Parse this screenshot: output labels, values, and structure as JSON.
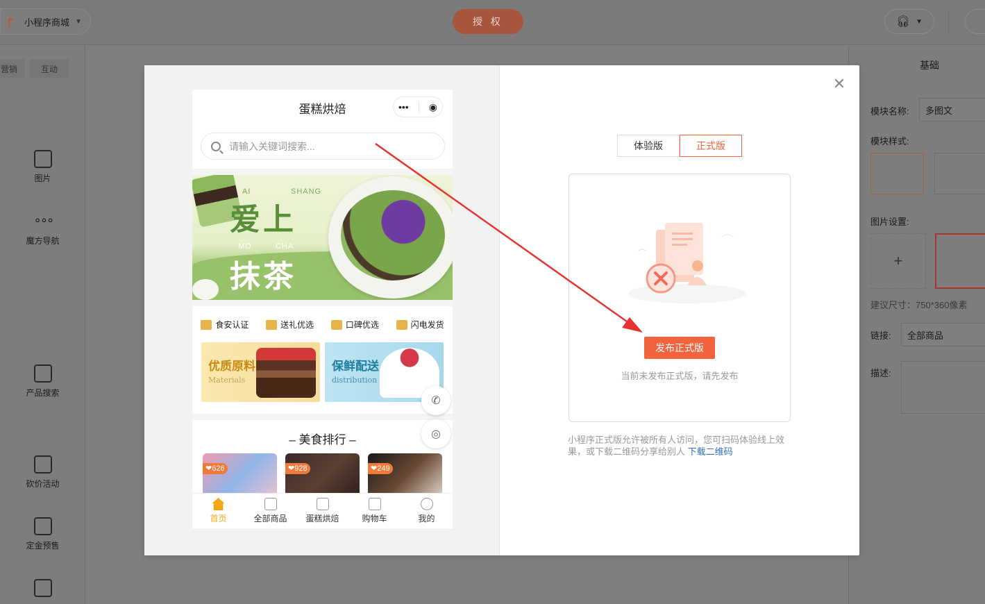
{
  "topbar": {
    "store_name": "小程序商城",
    "auth_label": "授 权"
  },
  "left_panel": {
    "tabs": [
      "营销",
      "互动"
    ],
    "tools": [
      {
        "label": "图片",
        "icon": "image-icon"
      },
      {
        "label": "魔方导航",
        "icon": "grid-dots-icon"
      },
      {
        "label": "产品搜索",
        "icon": "product-search-icon"
      },
      {
        "label": "砍价活动",
        "icon": "bargain-tag-icon"
      },
      {
        "label": "定金预售",
        "icon": "presale-icon"
      },
      {
        "label": "",
        "icon": "video-tv-icon"
      }
    ]
  },
  "right_panel": {
    "title": "基础",
    "module_name_label": "模块名称:",
    "module_name_value": "多图文",
    "module_style_label": "模块样式:",
    "image_settings_label": "图片设置:",
    "recommended_size": "建议尺寸：750*360像素",
    "link_label": "链接:",
    "link_value": "全部商品",
    "description_label": "描述:"
  },
  "phone": {
    "title": "蛋糕烘焙",
    "search_placeholder": "请输入关键词搜索...",
    "banner": {
      "line1": "爱上",
      "line2": "抹茶",
      "small_ai": "AI",
      "small_shang": "SHANG",
      "small_mo": "MO",
      "small_cha": "CHA"
    },
    "features": [
      "食安认证",
      "送礼优选",
      "口碑优选",
      "闪电发货"
    ],
    "promos": [
      {
        "title": "优质原料",
        "subtitle": "Materials"
      },
      {
        "title": "保鲜配送",
        "subtitle": "distribution"
      }
    ],
    "ranking_title": "美食排行",
    "ranking_items": [
      {
        "likes": "626"
      },
      {
        "likes": "928"
      },
      {
        "likes": "249"
      }
    ],
    "tabs": [
      "首页",
      "全部商品",
      "蛋糕烘焙",
      "购物车",
      "我的"
    ],
    "active_tab": "首页"
  },
  "modal": {
    "versions": [
      "体验版",
      "正式版"
    ],
    "active_version": "正式版",
    "publish_button": "发布正式版",
    "not_published_text": "当前未发布正式版，请先发布",
    "note_text": "小程序正式版允许被所有人访问，您可扫码体验线上效果，或下载二维码分享给别人",
    "note_link": "下载二维码"
  },
  "colors": {
    "accent": "#f2633e",
    "active_tab": "#f3a714",
    "link": "#2d6fc0",
    "arrow": "#e8322f"
  }
}
